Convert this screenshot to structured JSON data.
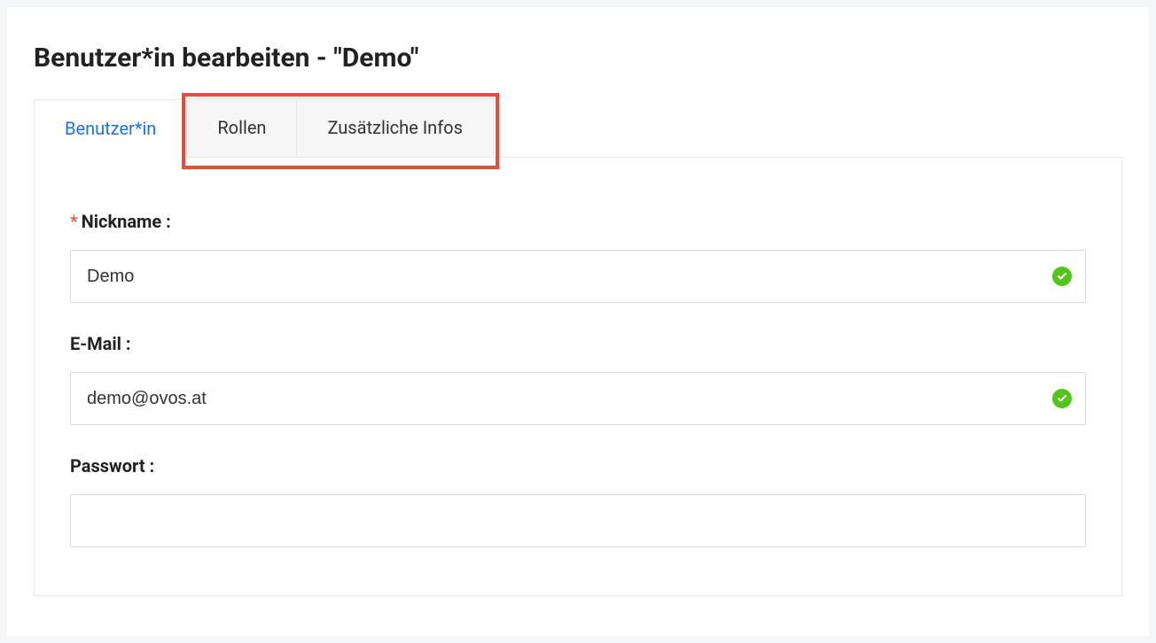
{
  "pageTitle": "Benutzer*in bearbeiten - \"Demo\"",
  "tabs": {
    "user": "Benutzer*in",
    "roles": "Rollen",
    "extra": "Zusätzliche Infos"
  },
  "form": {
    "nickname": {
      "label": "Nickname :",
      "value": "Demo",
      "required": true,
      "valid": true
    },
    "email": {
      "label": "E-Mail :",
      "value": "demo@ovos.at",
      "required": false,
      "valid": true
    },
    "password": {
      "label": "Passwort :",
      "value": "",
      "required": false,
      "valid": false
    }
  },
  "requiredMark": "*"
}
